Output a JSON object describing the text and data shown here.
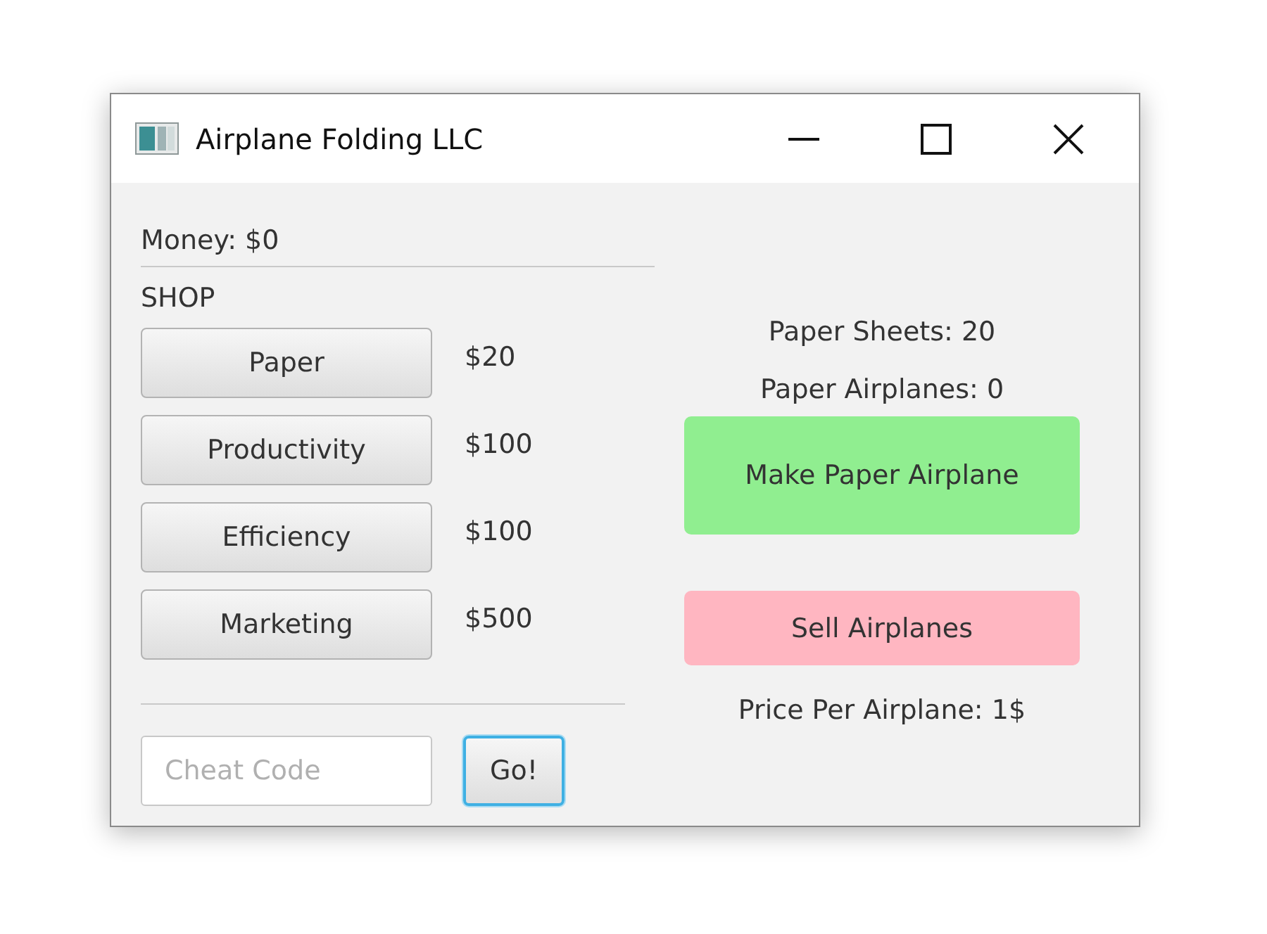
{
  "window": {
    "title": "Airplane Folding LLC"
  },
  "money": "Money: $0",
  "shop": {
    "heading": "SHOP",
    "items": [
      {
        "label": "Paper",
        "price": "$20"
      },
      {
        "label": "Productivity",
        "price": "$100"
      },
      {
        "label": "Efficiency",
        "price": "$100"
      },
      {
        "label": "Marketing",
        "price": "$500"
      }
    ]
  },
  "cheat": {
    "placeholder": "Cheat Code",
    "button": {
      "label": "Go!",
      "focused": true
    }
  },
  "stats": [
    "Paper Sheets: 20",
    "Paper Airplanes: 0"
  ],
  "actions": [
    {
      "label": "Make Paper Airplane",
      "color": "#90ee90"
    },
    {
      "label": "Sell Airplanes",
      "color": "#ffb6c1"
    }
  ],
  "price": "Price Per Airplane: 1$"
}
